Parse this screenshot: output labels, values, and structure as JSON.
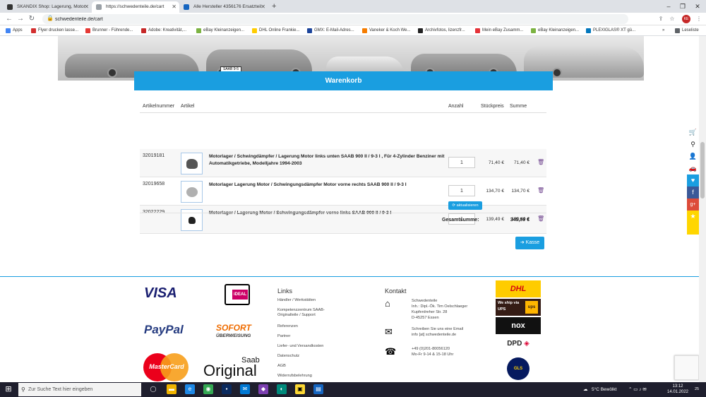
{
  "browser": {
    "tabs": [
      {
        "title": "SKANDIX Shop: Lagerung, Motor"
      },
      {
        "title": "https://schwedenteile.de/cart"
      },
      {
        "title": "Alle Hersteller 4356176 Ersatzteil"
      }
    ],
    "new_tab": "+",
    "address": "schwedenteile.de/cart",
    "profile_initials": "KE",
    "bookmarks": [
      {
        "label": "Apps",
        "color": "#4285f4"
      },
      {
        "label": "Flyer drucken lasse...",
        "color": "#d32f2f"
      },
      {
        "label": "Brunner - Führende...",
        "color": "#e53935"
      },
      {
        "label": "Adobe: Kreativität,...",
        "color": "#c62828"
      },
      {
        "label": "eBay Kleinanzeigen...",
        "color": "#7cb342"
      },
      {
        "label": "DHL Online Frankie...",
        "color": "#ffcc00"
      },
      {
        "label": "GMX: E-Mail-Adres...",
        "color": "#1c449b"
      },
      {
        "label": "Vaneker & Koch We...",
        "color": "#f57c00"
      },
      {
        "label": "Archivfotos, lizenzfr...",
        "color": "#222222"
      },
      {
        "label": "Mein eBay Zusamm...",
        "color": "#e53238"
      },
      {
        "label": "eBay Kleinanzeigen...",
        "color": "#7cb342"
      },
      {
        "label": "PLEXIGLAS® XT gü...",
        "color": "#0277bd"
      }
    ],
    "reading_list": "Leseliste"
  },
  "hero": {
    "plate": "SAAB 9-5"
  },
  "cart": {
    "title": "Warenkorb",
    "headers": {
      "article_no": "Artikelnummer",
      "article": "Artikel",
      "qty": "Anzahl",
      "unit_price": "Stückpreis",
      "sum": "Summe"
    },
    "items": [
      {
        "article_no": "32019181",
        "description": "Motorlager / Schwingdämpfer / Lagerung Motor links unten SAAB 900 II / 9-3 I , Für 4-Zylinder Benziner mit Automatikgetriebe, Modelljahre 1994-2003",
        "qty": "1",
        "unit_price": "71,40 €",
        "sum": "71,40 €"
      },
      {
        "article_no": "32019658",
        "description": "Motorlager Lagerung Motor / Schwingungsdämpfer Motor vorne rechts SAAB 900 II / 9-3 I",
        "qty": "1",
        "unit_price": "134,70 €",
        "sum": "134,70 €"
      },
      {
        "article_no": "32022229",
        "description": "Motorlager / Lagerung Motor / Schwingungsdämpfer vorne links SAAB 900 II / 9-3 I",
        "qty": "1",
        "unit_price": "139,49 €",
        "sum": "139,49 €"
      }
    ],
    "update_label": "aktualisieren",
    "total_label": "Gesamtsumme:",
    "total_value": "345,59 €",
    "checkout_label": "Kasse"
  },
  "footer": {
    "payments": {
      "visa": "VISA",
      "ideal": "iDEAL",
      "paypal": "PayPal",
      "sofort": "SOFORT",
      "sofort_sub": "ÜBERWEISUNG",
      "mastercard": "MasterCard",
      "original_saab": "Saab",
      "original": "Original"
    },
    "links_title": "Links",
    "links": [
      "Händler / Werkstätten",
      "Kompetenzzentrum SAAB-Originalteile / Support",
      "Referenzen",
      "Partner",
      "Liefer- und Versandkosten",
      "Datenschutz",
      "AGB",
      "Widerrufsbelehrung"
    ],
    "contact_title": "Kontakt",
    "contact": {
      "address_lines": [
        "Schwedenteile",
        "Inh.: Dipl.-Ök. Tim Oelschlaeger",
        "Kupferdreher Str. 28",
        "D-45257 Essen"
      ],
      "email_lines": [
        "Schreiben Sie uns eine Email",
        "info [at] schwedenteile.de"
      ],
      "phone_lines": [
        "+49 (0)201-80056120",
        "Mo-Fr 9-14 & 15-18 Uhr"
      ]
    },
    "carriers": {
      "dhl": "DHL",
      "ups_text": "We ship via UPS",
      "ups_logo": "ups",
      "nox": "nox",
      "dpd": "DPD",
      "gls": "GLS"
    }
  },
  "taskbar": {
    "search_placeholder": "Zur Suche Text hier eingeben",
    "weather": "5°C  Bewölkt",
    "time": "13:12",
    "date": "14.01.2022",
    "notifications": "25"
  }
}
